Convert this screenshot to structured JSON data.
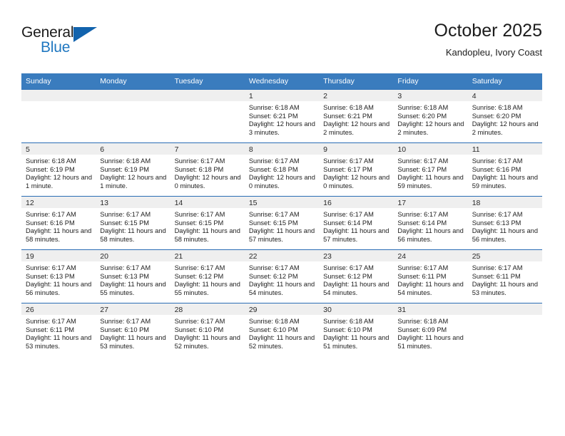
{
  "brand": {
    "name_top": "General",
    "name_bottom": "Blue",
    "accent_color": "#1f77c0",
    "triangle_color": "#1263ad"
  },
  "header": {
    "title": "October 2025",
    "subtitle": "Kandopleu, Ivory Coast"
  },
  "theme": {
    "header_row_bg": "#3a7cbe",
    "row_border": "#2a6db5",
    "daynum_band_bg": "#efefef"
  },
  "weekday_headers": [
    "Sunday",
    "Monday",
    "Tuesday",
    "Wednesday",
    "Thursday",
    "Friday",
    "Saturday"
  ],
  "weeks": [
    [
      {
        "day": "",
        "empty": true,
        "sunrise": "",
        "sunset": "",
        "daylight": ""
      },
      {
        "day": "",
        "empty": true,
        "sunrise": "",
        "sunset": "",
        "daylight": ""
      },
      {
        "day": "",
        "empty": true,
        "sunrise": "",
        "sunset": "",
        "daylight": ""
      },
      {
        "day": "1",
        "sunrise": "Sunrise: 6:18 AM",
        "sunset": "Sunset: 6:21 PM",
        "daylight": "Daylight: 12 hours and 3 minutes."
      },
      {
        "day": "2",
        "sunrise": "Sunrise: 6:18 AM",
        "sunset": "Sunset: 6:21 PM",
        "daylight": "Daylight: 12 hours and 2 minutes."
      },
      {
        "day": "3",
        "sunrise": "Sunrise: 6:18 AM",
        "sunset": "Sunset: 6:20 PM",
        "daylight": "Daylight: 12 hours and 2 minutes."
      },
      {
        "day": "4",
        "sunrise": "Sunrise: 6:18 AM",
        "sunset": "Sunset: 6:20 PM",
        "daylight": "Daylight: 12 hours and 2 minutes."
      }
    ],
    [
      {
        "day": "5",
        "sunrise": "Sunrise: 6:18 AM",
        "sunset": "Sunset: 6:19 PM",
        "daylight": "Daylight: 12 hours and 1 minute."
      },
      {
        "day": "6",
        "sunrise": "Sunrise: 6:18 AM",
        "sunset": "Sunset: 6:19 PM",
        "daylight": "Daylight: 12 hours and 1 minute."
      },
      {
        "day": "7",
        "sunrise": "Sunrise: 6:17 AM",
        "sunset": "Sunset: 6:18 PM",
        "daylight": "Daylight: 12 hours and 0 minutes."
      },
      {
        "day": "8",
        "sunrise": "Sunrise: 6:17 AM",
        "sunset": "Sunset: 6:18 PM",
        "daylight": "Daylight: 12 hours and 0 minutes."
      },
      {
        "day": "9",
        "sunrise": "Sunrise: 6:17 AM",
        "sunset": "Sunset: 6:17 PM",
        "daylight": "Daylight: 12 hours and 0 minutes."
      },
      {
        "day": "10",
        "sunrise": "Sunrise: 6:17 AM",
        "sunset": "Sunset: 6:17 PM",
        "daylight": "Daylight: 11 hours and 59 minutes."
      },
      {
        "day": "11",
        "sunrise": "Sunrise: 6:17 AM",
        "sunset": "Sunset: 6:16 PM",
        "daylight": "Daylight: 11 hours and 59 minutes."
      }
    ],
    [
      {
        "day": "12",
        "sunrise": "Sunrise: 6:17 AM",
        "sunset": "Sunset: 6:16 PM",
        "daylight": "Daylight: 11 hours and 58 minutes."
      },
      {
        "day": "13",
        "sunrise": "Sunrise: 6:17 AM",
        "sunset": "Sunset: 6:15 PM",
        "daylight": "Daylight: 11 hours and 58 minutes."
      },
      {
        "day": "14",
        "sunrise": "Sunrise: 6:17 AM",
        "sunset": "Sunset: 6:15 PM",
        "daylight": "Daylight: 11 hours and 58 minutes."
      },
      {
        "day": "15",
        "sunrise": "Sunrise: 6:17 AM",
        "sunset": "Sunset: 6:15 PM",
        "daylight": "Daylight: 11 hours and 57 minutes."
      },
      {
        "day": "16",
        "sunrise": "Sunrise: 6:17 AM",
        "sunset": "Sunset: 6:14 PM",
        "daylight": "Daylight: 11 hours and 57 minutes."
      },
      {
        "day": "17",
        "sunrise": "Sunrise: 6:17 AM",
        "sunset": "Sunset: 6:14 PM",
        "daylight": "Daylight: 11 hours and 56 minutes."
      },
      {
        "day": "18",
        "sunrise": "Sunrise: 6:17 AM",
        "sunset": "Sunset: 6:13 PM",
        "daylight": "Daylight: 11 hours and 56 minutes."
      }
    ],
    [
      {
        "day": "19",
        "sunrise": "Sunrise: 6:17 AM",
        "sunset": "Sunset: 6:13 PM",
        "daylight": "Daylight: 11 hours and 56 minutes."
      },
      {
        "day": "20",
        "sunrise": "Sunrise: 6:17 AM",
        "sunset": "Sunset: 6:13 PM",
        "daylight": "Daylight: 11 hours and 55 minutes."
      },
      {
        "day": "21",
        "sunrise": "Sunrise: 6:17 AM",
        "sunset": "Sunset: 6:12 PM",
        "daylight": "Daylight: 11 hours and 55 minutes."
      },
      {
        "day": "22",
        "sunrise": "Sunrise: 6:17 AM",
        "sunset": "Sunset: 6:12 PM",
        "daylight": "Daylight: 11 hours and 54 minutes."
      },
      {
        "day": "23",
        "sunrise": "Sunrise: 6:17 AM",
        "sunset": "Sunset: 6:12 PM",
        "daylight": "Daylight: 11 hours and 54 minutes."
      },
      {
        "day": "24",
        "sunrise": "Sunrise: 6:17 AM",
        "sunset": "Sunset: 6:11 PM",
        "daylight": "Daylight: 11 hours and 54 minutes."
      },
      {
        "day": "25",
        "sunrise": "Sunrise: 6:17 AM",
        "sunset": "Sunset: 6:11 PM",
        "daylight": "Daylight: 11 hours and 53 minutes."
      }
    ],
    [
      {
        "day": "26",
        "sunrise": "Sunrise: 6:17 AM",
        "sunset": "Sunset: 6:11 PM",
        "daylight": "Daylight: 11 hours and 53 minutes."
      },
      {
        "day": "27",
        "sunrise": "Sunrise: 6:17 AM",
        "sunset": "Sunset: 6:10 PM",
        "daylight": "Daylight: 11 hours and 53 minutes."
      },
      {
        "day": "28",
        "sunrise": "Sunrise: 6:17 AM",
        "sunset": "Sunset: 6:10 PM",
        "daylight": "Daylight: 11 hours and 52 minutes."
      },
      {
        "day": "29",
        "sunrise": "Sunrise: 6:18 AM",
        "sunset": "Sunset: 6:10 PM",
        "daylight": "Daylight: 11 hours and 52 minutes."
      },
      {
        "day": "30",
        "sunrise": "Sunrise: 6:18 AM",
        "sunset": "Sunset: 6:10 PM",
        "daylight": "Daylight: 11 hours and 51 minutes."
      },
      {
        "day": "31",
        "sunrise": "Sunrise: 6:18 AM",
        "sunset": "Sunset: 6:09 PM",
        "daylight": "Daylight: 11 hours and 51 minutes."
      },
      {
        "day": "",
        "empty": true,
        "sunrise": "",
        "sunset": "",
        "daylight": ""
      }
    ]
  ]
}
